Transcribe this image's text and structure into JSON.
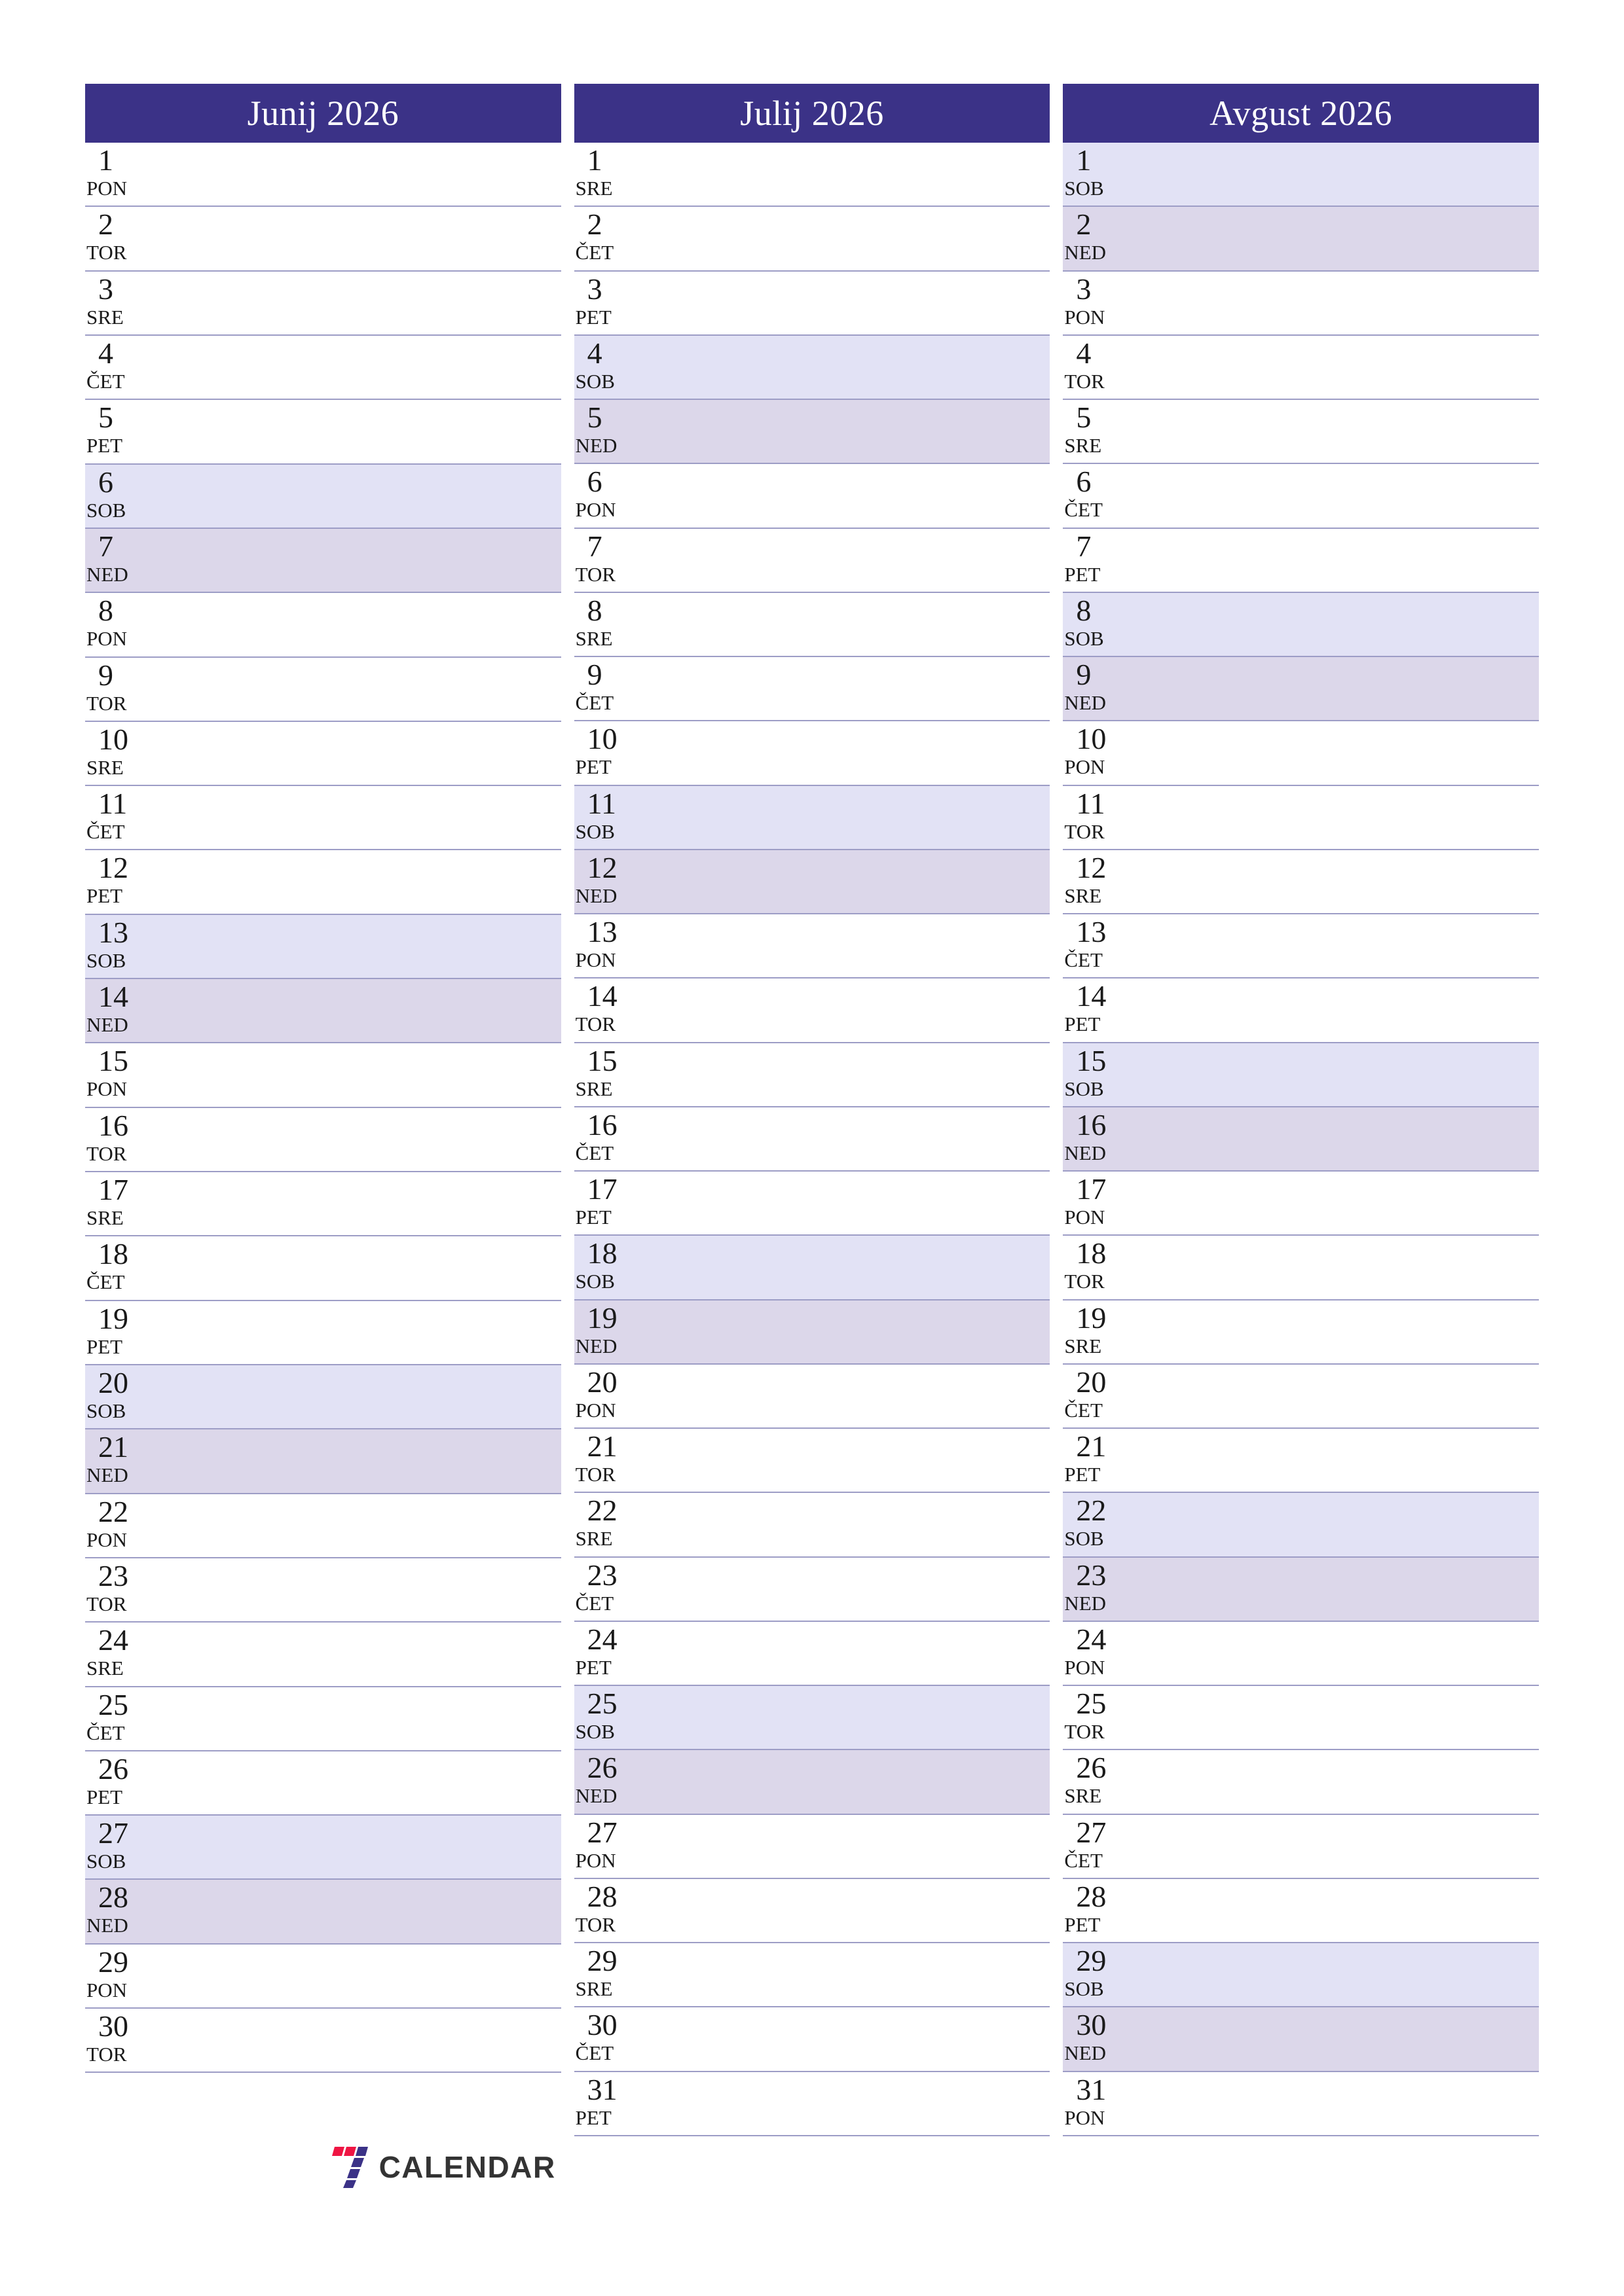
{
  "document": {
    "kind": "three-month-planner",
    "language": "sl",
    "year": "2026"
  },
  "theme": {
    "header_bg": "#3b3287",
    "header_text": "#ffffff",
    "saturday_bg": "#e2e2f5",
    "sunday_bg": "#dcd7ea",
    "row_rule": "#9d9dc6",
    "text": "#1a1a1a",
    "logo_red": "#ef1543",
    "logo_purple": "#3b3287",
    "logo_word": "#333333"
  },
  "brand": {
    "mark_name": "seven-logo-icon",
    "word": "CALENDAR"
  },
  "months": [
    {
      "title": "Junij 2026",
      "days": [
        {
          "num": "1",
          "dow": "PON",
          "type": "weekday"
        },
        {
          "num": "2",
          "dow": "TOR",
          "type": "weekday"
        },
        {
          "num": "3",
          "dow": "SRE",
          "type": "weekday"
        },
        {
          "num": "4",
          "dow": "ČET",
          "type": "weekday"
        },
        {
          "num": "5",
          "dow": "PET",
          "type": "weekday"
        },
        {
          "num": "6",
          "dow": "SOB",
          "type": "saturday"
        },
        {
          "num": "7",
          "dow": "NED",
          "type": "sunday"
        },
        {
          "num": "8",
          "dow": "PON",
          "type": "weekday"
        },
        {
          "num": "9",
          "dow": "TOR",
          "type": "weekday"
        },
        {
          "num": "10",
          "dow": "SRE",
          "type": "weekday"
        },
        {
          "num": "11",
          "dow": "ČET",
          "type": "weekday"
        },
        {
          "num": "12",
          "dow": "PET",
          "type": "weekday"
        },
        {
          "num": "13",
          "dow": "SOB",
          "type": "saturday"
        },
        {
          "num": "14",
          "dow": "NED",
          "type": "sunday"
        },
        {
          "num": "15",
          "dow": "PON",
          "type": "weekday"
        },
        {
          "num": "16",
          "dow": "TOR",
          "type": "weekday"
        },
        {
          "num": "17",
          "dow": "SRE",
          "type": "weekday"
        },
        {
          "num": "18",
          "dow": "ČET",
          "type": "weekday"
        },
        {
          "num": "19",
          "dow": "PET",
          "type": "weekday"
        },
        {
          "num": "20",
          "dow": "SOB",
          "type": "saturday"
        },
        {
          "num": "21",
          "dow": "NED",
          "type": "sunday"
        },
        {
          "num": "22",
          "dow": "PON",
          "type": "weekday"
        },
        {
          "num": "23",
          "dow": "TOR",
          "type": "weekday"
        },
        {
          "num": "24",
          "dow": "SRE",
          "type": "weekday"
        },
        {
          "num": "25",
          "dow": "ČET",
          "type": "weekday"
        },
        {
          "num": "26",
          "dow": "PET",
          "type": "weekday"
        },
        {
          "num": "27",
          "dow": "SOB",
          "type": "saturday"
        },
        {
          "num": "28",
          "dow": "NED",
          "type": "sunday"
        },
        {
          "num": "29",
          "dow": "PON",
          "type": "weekday"
        },
        {
          "num": "30",
          "dow": "TOR",
          "type": "weekday"
        }
      ],
      "has_brand": true
    },
    {
      "title": "Julij 2026",
      "days": [
        {
          "num": "1",
          "dow": "SRE",
          "type": "weekday"
        },
        {
          "num": "2",
          "dow": "ČET",
          "type": "weekday"
        },
        {
          "num": "3",
          "dow": "PET",
          "type": "weekday"
        },
        {
          "num": "4",
          "dow": "SOB",
          "type": "saturday"
        },
        {
          "num": "5",
          "dow": "NED",
          "type": "sunday"
        },
        {
          "num": "6",
          "dow": "PON",
          "type": "weekday"
        },
        {
          "num": "7",
          "dow": "TOR",
          "type": "weekday"
        },
        {
          "num": "8",
          "dow": "SRE",
          "type": "weekday"
        },
        {
          "num": "9",
          "dow": "ČET",
          "type": "weekday"
        },
        {
          "num": "10",
          "dow": "PET",
          "type": "weekday"
        },
        {
          "num": "11",
          "dow": "SOB",
          "type": "saturday"
        },
        {
          "num": "12",
          "dow": "NED",
          "type": "sunday"
        },
        {
          "num": "13",
          "dow": "PON",
          "type": "weekday"
        },
        {
          "num": "14",
          "dow": "TOR",
          "type": "weekday"
        },
        {
          "num": "15",
          "dow": "SRE",
          "type": "weekday"
        },
        {
          "num": "16",
          "dow": "ČET",
          "type": "weekday"
        },
        {
          "num": "17",
          "dow": "PET",
          "type": "weekday"
        },
        {
          "num": "18",
          "dow": "SOB",
          "type": "saturday"
        },
        {
          "num": "19",
          "dow": "NED",
          "type": "sunday"
        },
        {
          "num": "20",
          "dow": "PON",
          "type": "weekday"
        },
        {
          "num": "21",
          "dow": "TOR",
          "type": "weekday"
        },
        {
          "num": "22",
          "dow": "SRE",
          "type": "weekday"
        },
        {
          "num": "23",
          "dow": "ČET",
          "type": "weekday"
        },
        {
          "num": "24",
          "dow": "PET",
          "type": "weekday"
        },
        {
          "num": "25",
          "dow": "SOB",
          "type": "saturday"
        },
        {
          "num": "26",
          "dow": "NED",
          "type": "sunday"
        },
        {
          "num": "27",
          "dow": "PON",
          "type": "weekday"
        },
        {
          "num": "28",
          "dow": "TOR",
          "type": "weekday"
        },
        {
          "num": "29",
          "dow": "SRE",
          "type": "weekday"
        },
        {
          "num": "30",
          "dow": "ČET",
          "type": "weekday"
        },
        {
          "num": "31",
          "dow": "PET",
          "type": "weekday"
        }
      ],
      "has_brand": false
    },
    {
      "title": "Avgust 2026",
      "days": [
        {
          "num": "1",
          "dow": "SOB",
          "type": "saturday"
        },
        {
          "num": "2",
          "dow": "NED",
          "type": "sunday"
        },
        {
          "num": "3",
          "dow": "PON",
          "type": "weekday"
        },
        {
          "num": "4",
          "dow": "TOR",
          "type": "weekday"
        },
        {
          "num": "5",
          "dow": "SRE",
          "type": "weekday"
        },
        {
          "num": "6",
          "dow": "ČET",
          "type": "weekday"
        },
        {
          "num": "7",
          "dow": "PET",
          "type": "weekday"
        },
        {
          "num": "8",
          "dow": "SOB",
          "type": "saturday"
        },
        {
          "num": "9",
          "dow": "NED",
          "type": "sunday"
        },
        {
          "num": "10",
          "dow": "PON",
          "type": "weekday"
        },
        {
          "num": "11",
          "dow": "TOR",
          "type": "weekday"
        },
        {
          "num": "12",
          "dow": "SRE",
          "type": "weekday"
        },
        {
          "num": "13",
          "dow": "ČET",
          "type": "weekday"
        },
        {
          "num": "14",
          "dow": "PET",
          "type": "weekday"
        },
        {
          "num": "15",
          "dow": "SOB",
          "type": "saturday"
        },
        {
          "num": "16",
          "dow": "NED",
          "type": "sunday"
        },
        {
          "num": "17",
          "dow": "PON",
          "type": "weekday"
        },
        {
          "num": "18",
          "dow": "TOR",
          "type": "weekday"
        },
        {
          "num": "19",
          "dow": "SRE",
          "type": "weekday"
        },
        {
          "num": "20",
          "dow": "ČET",
          "type": "weekday"
        },
        {
          "num": "21",
          "dow": "PET",
          "type": "weekday"
        },
        {
          "num": "22",
          "dow": "SOB",
          "type": "saturday"
        },
        {
          "num": "23",
          "dow": "NED",
          "type": "sunday"
        },
        {
          "num": "24",
          "dow": "PON",
          "type": "weekday"
        },
        {
          "num": "25",
          "dow": "TOR",
          "type": "weekday"
        },
        {
          "num": "26",
          "dow": "SRE",
          "type": "weekday"
        },
        {
          "num": "27",
          "dow": "ČET",
          "type": "weekday"
        },
        {
          "num": "28",
          "dow": "PET",
          "type": "weekday"
        },
        {
          "num": "29",
          "dow": "SOB",
          "type": "saturday"
        },
        {
          "num": "30",
          "dow": "NED",
          "type": "sunday"
        },
        {
          "num": "31",
          "dow": "PON",
          "type": "weekday"
        }
      ],
      "has_brand": false
    }
  ]
}
